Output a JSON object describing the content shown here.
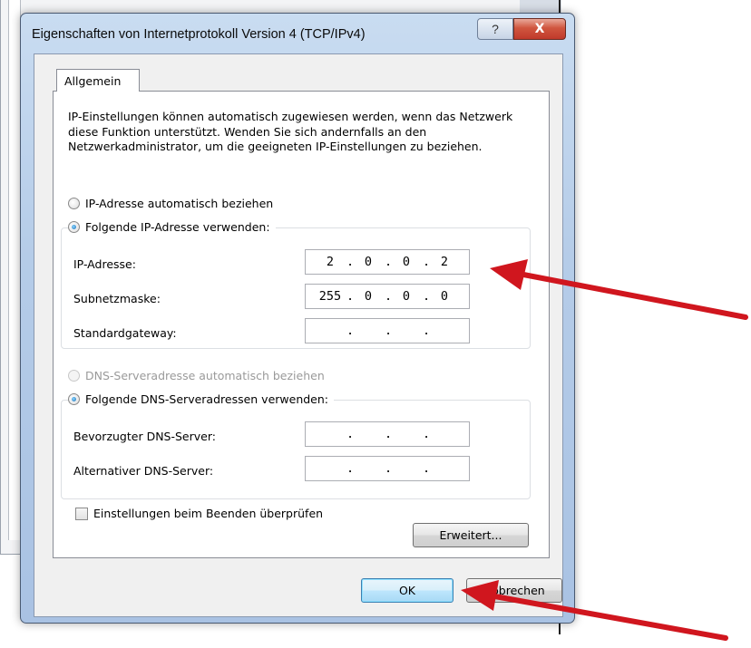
{
  "dialog": {
    "title": "Eigenschaften von Internetprotokoll Version 4 (TCP/IPv4)",
    "help_label": "?",
    "close_label": "X"
  },
  "tab": {
    "label": "Allgemein"
  },
  "description": "IP-Einstellungen können automatisch zugewiesen werden, wenn das Netzwerk diese Funktion unterstützt. Wenden Sie sich andernfalls an den Netzwerkadministrator, um die geeigneten IP-Einstellungen zu beziehen.",
  "ip": {
    "auto_label": "IP-Adresse automatisch beziehen",
    "auto_selected": false,
    "manual_label": "Folgende IP-Adresse verwenden:",
    "manual_selected": true,
    "address_label": "IP-Adresse:",
    "address": [
      "2",
      "0",
      "0",
      "2"
    ],
    "subnet_label": "Subnetzmaske:",
    "subnet": [
      "255",
      "0",
      "0",
      "0"
    ],
    "gateway_label": "Standardgateway:",
    "gateway": [
      "",
      "",
      "",
      ""
    ]
  },
  "dns": {
    "auto_label": "DNS-Serveradresse automatisch beziehen",
    "auto_disabled": true,
    "manual_label": "Folgende DNS-Serveradressen verwenden:",
    "manual_selected": true,
    "preferred_label": "Bevorzugter DNS-Server:",
    "preferred": [
      "",
      "",
      "",
      ""
    ],
    "alternate_label": "Alternativer DNS-Server:",
    "alternate": [
      "",
      "",
      "",
      ""
    ]
  },
  "validate_label": "Einstellungen beim Beenden überprüfen",
  "validate_checked": false,
  "buttons": {
    "advanced": "Erweitert...",
    "ok": "OK",
    "cancel": "Abbrechen"
  },
  "annotation_color": "#d0161e"
}
